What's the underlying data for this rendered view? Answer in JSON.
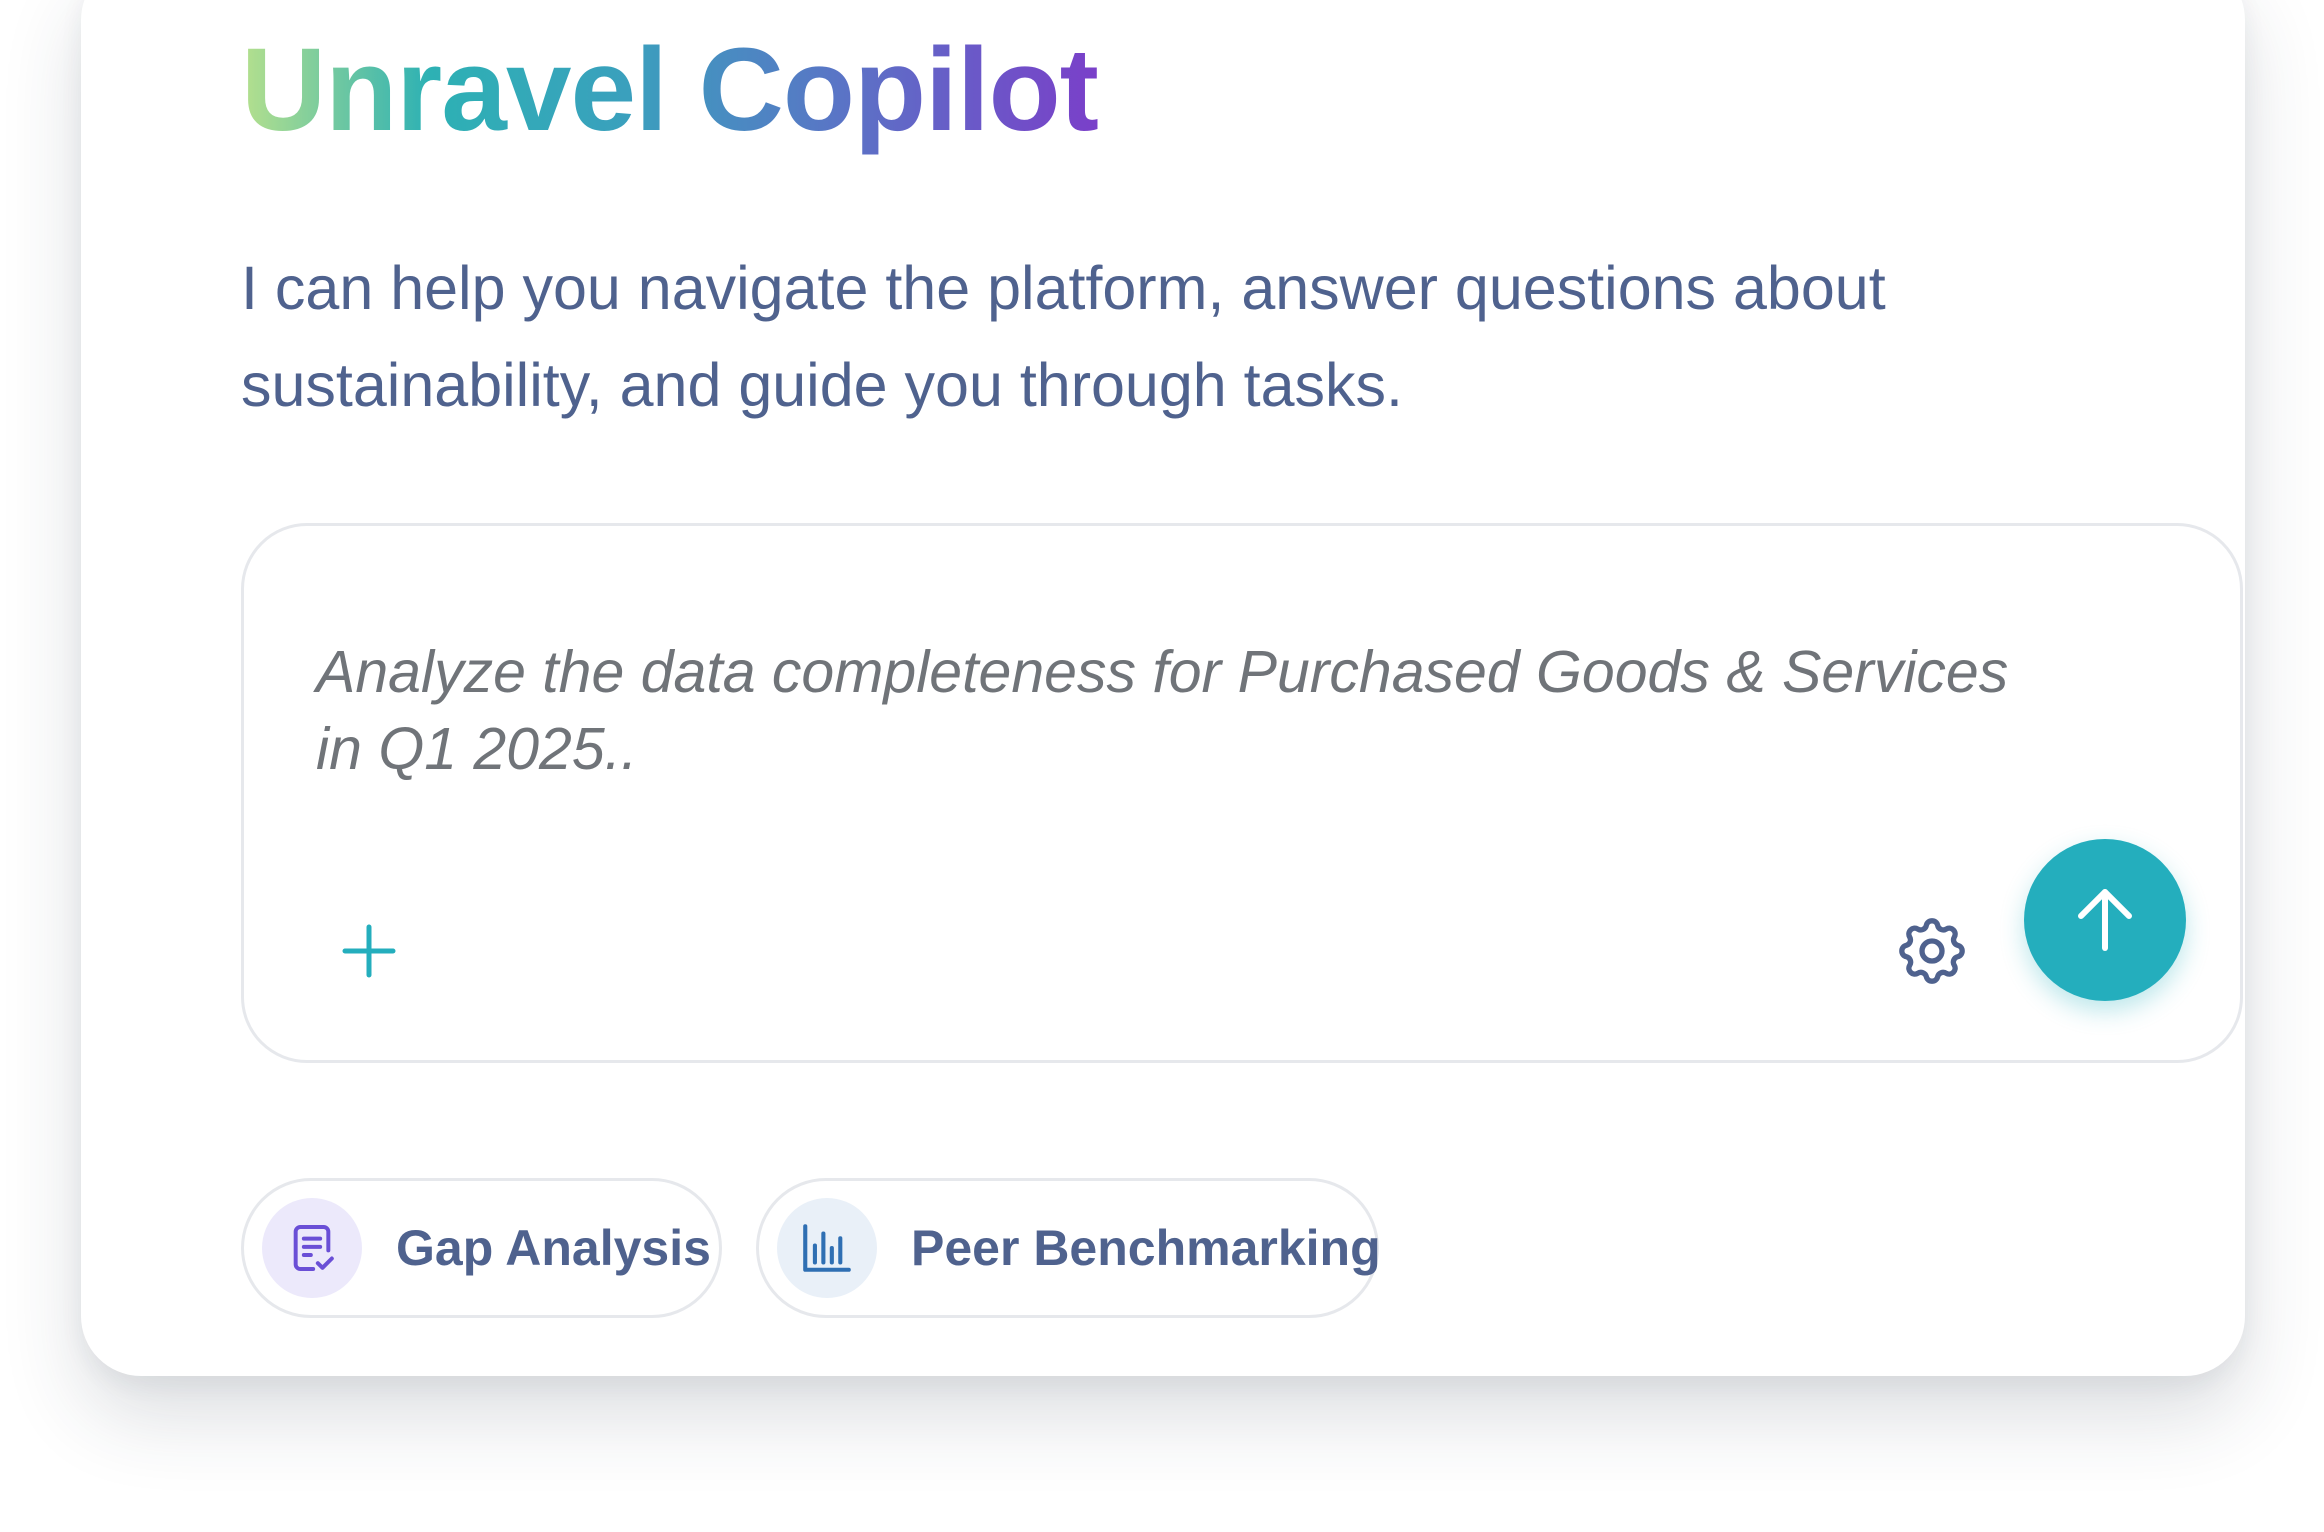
{
  "header": {
    "title": "Unravel Copilot",
    "subtitle": "I can help you navigate the platform, answer questions about sustainability, and guide you through tasks."
  },
  "composer": {
    "placeholder_line1": "Analyze the data completeness for Purchased Goods & Services",
    "placeholder_line2": "in Q1 2025..",
    "icons": {
      "add": "plus-icon",
      "settings": "gear-icon",
      "send": "arrow-up-icon"
    }
  },
  "suggestions": [
    {
      "label": "Gap Analysis",
      "icon": "checklist-document-icon"
    },
    {
      "label": "Peer Benchmarking",
      "icon": "bar-chart-icon"
    }
  ],
  "colors": {
    "accent": "#24aebd",
    "text_primary": "#4f628e",
    "placeholder": "#707479",
    "title_gradient": [
      "#b5e08d",
      "#2db1b4",
      "#5a74c6",
      "#7a3fc9"
    ],
    "gap_icon": "#6a4fd6",
    "peer_icon": "#2f6fb3"
  }
}
